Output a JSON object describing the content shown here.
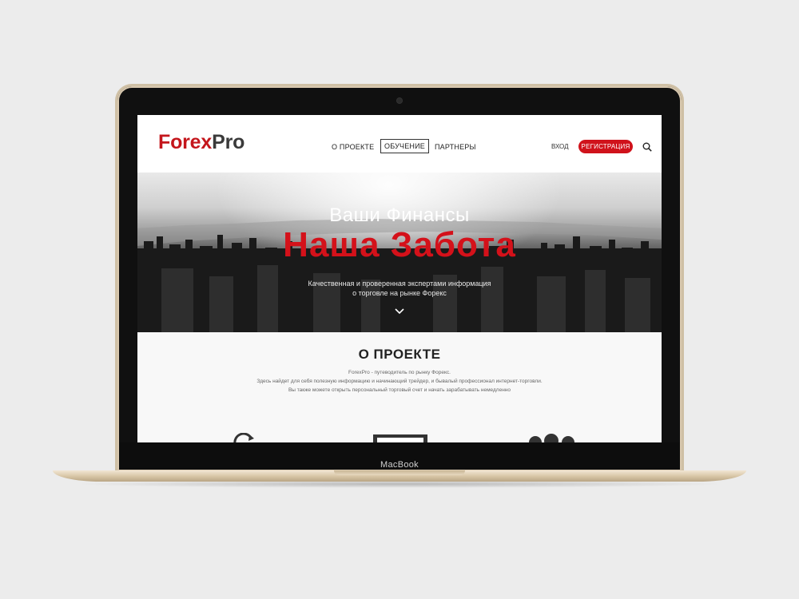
{
  "device": {
    "brand": "MacBook"
  },
  "header": {
    "logo": {
      "part1": "Forex",
      "part2": "Pro"
    },
    "nav": [
      {
        "label": "О ПРОЕКТЕ"
      },
      {
        "label": "ОБУЧЕНИЕ"
      },
      {
        "label": "ПАРТНЕРЫ"
      }
    ],
    "login_label": "ВХОД",
    "register_label": "РЕГИСТРАЦИЯ",
    "search_icon": "search-icon"
  },
  "hero": {
    "line1": "Ваши Финансы",
    "line2": "Наша Забота",
    "subtitle_line1": "Качественная и проверенная экспертами информация",
    "subtitle_line2": "о торговле на рынке Форекс",
    "arrow_icon": "chevron-down-icon"
  },
  "about": {
    "title": "О ПРОЕКТЕ",
    "text_line1": "ForexPro - путеводитель по рынку Форекс.",
    "text_line2": "Здесь найдет для себя полезную информацию и начинающий трейдер, и бывалый профессионал интернет-торговли.",
    "text_line3": "Вы также можете открыть персональный торговый счет и начать зарабатывать немедленно"
  },
  "colors": {
    "accent": "#d0121b",
    "logo_red": "#c4161c"
  }
}
